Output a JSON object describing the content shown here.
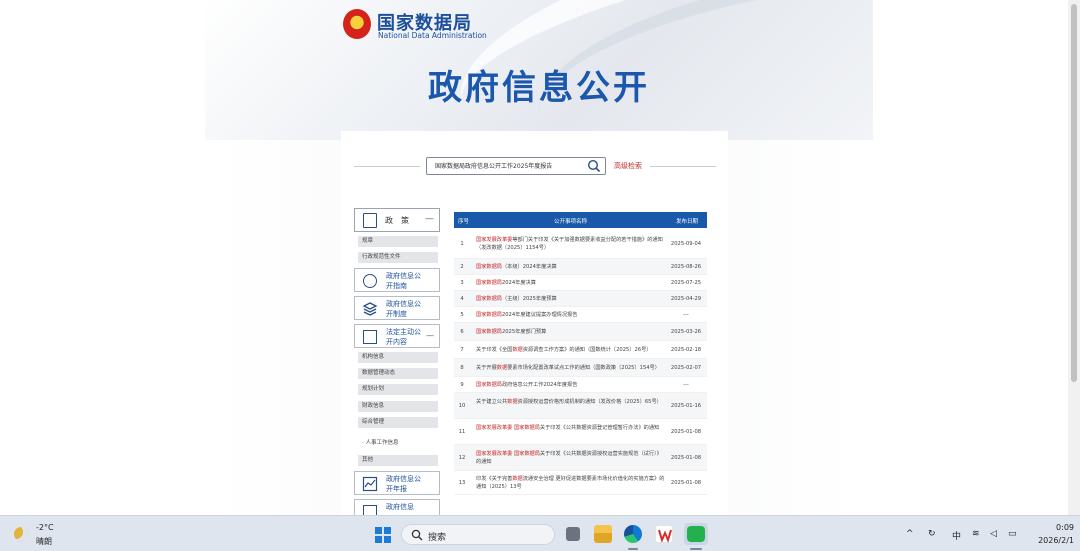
{
  "site": {
    "logo_cn": "国家数据局",
    "logo_en": "National Data Administration",
    "page_title": "政府信息公开"
  },
  "search": {
    "query": "国家数据局政府信息公开工作2025年度报告",
    "advanced_label": "高级检索"
  },
  "sidebar": {
    "head_label": "政策",
    "items": [
      {
        "kind": "gray",
        "label": "规章"
      },
      {
        "kind": "gray",
        "label": "行政规范性文件"
      },
      {
        "kind": "card",
        "label": "政府信息公开指南",
        "icon": "compass-icon"
      },
      {
        "kind": "card",
        "label": "政府信息公开制度",
        "icon": "layers-icon"
      },
      {
        "kind": "card",
        "label": "法定主动公开内容",
        "icon": "document-list-icon"
      },
      {
        "kind": "gray",
        "label": "机构信息"
      },
      {
        "kind": "gray",
        "label": "数据管理动态"
      },
      {
        "kind": "gray",
        "label": "规划计划"
      },
      {
        "kind": "gray",
        "label": "财政信息"
      },
      {
        "kind": "gray",
        "label": "综合管理"
      },
      {
        "kind": "sub",
        "label": "· 人事工作信息"
      },
      {
        "kind": "gray",
        "label": "其他"
      },
      {
        "kind": "card",
        "label": "政府信息公开年报",
        "icon": "chart-icon"
      },
      {
        "kind": "card",
        "label": "政府信息",
        "icon": "doc-icon"
      }
    ]
  },
  "table": {
    "headers": [
      "序号",
      "公开事项名称",
      "发布日期"
    ],
    "rows": [
      {
        "no": "1",
        "pre": "",
        "red": "国家发展改革委",
        "post": "等部门关于印发《关于加强数据要素收益分配的若干措施》的通知（发改数据〔2025〕1154号）",
        "date": "2025-09-04"
      },
      {
        "no": "2",
        "pre": "",
        "red": "国家数据局",
        "post": "（本级）2024年度决算",
        "date": "2025-08-26"
      },
      {
        "no": "3",
        "pre": "",
        "red": "国家数据局",
        "post": "2024年度决算",
        "date": "2025-07-25"
      },
      {
        "no": "4",
        "pre": "",
        "red": "国家数据局",
        "post": "（主级）2025年度预算",
        "date": "2025-04-29"
      },
      {
        "no": "5",
        "pre": "",
        "red": "国家数据局",
        "post": "2024年度建议提案办理情况报告",
        "date": "---"
      },
      {
        "no": "6",
        "pre": "",
        "red": "国家数据局",
        "post": "2025年度部门预算",
        "date": "2025-03-26"
      },
      {
        "no": "7",
        "pre": "关于印发《全国",
        "red": "数据",
        "post": "资源调查工作方案》的通知（国数统计〔2025〕26号）",
        "date": "2025-02-18"
      },
      {
        "no": "8",
        "pre": "关于开展",
        "red": "数据",
        "post": "要素市场化配置改革试点工作的通知（国数政策〔2025〕154号）",
        "date": "2025-02-07"
      },
      {
        "no": "9",
        "pre": "",
        "red": "国家数据局",
        "post": "政府信息公开工作2024年度报告",
        "date": "---"
      },
      {
        "no": "10",
        "pre": "关于建立公共",
        "red": "数据",
        "post": "资源授权运营价格形成机制的通知（发改价格〔2025〕65号）",
        "date": "2025-01-16"
      },
      {
        "no": "11",
        "pre": "",
        "red": "国家发展改革委 国家数据局",
        "post": "关于印发《公共数据资源登记管理暂行办法》的通知",
        "date": "2025-01-08"
      },
      {
        "no": "12",
        "pre": "",
        "red": "国家发展改革委 国家数据局",
        "post": "关于印发《公共数据资源授权运营实施规范（试行）》的通知",
        "date": "2025-01-08"
      },
      {
        "no": "13",
        "pre": "印发《关于完善",
        "red": "数据",
        "post": "流通安全治理 更好促进数据要素市场化价值化的实施方案》的通知（2025）13号",
        "date": "2025-01-08"
      }
    ]
  },
  "taskbar": {
    "weather_temp": "-2°C",
    "weather_desc": "晴朗",
    "search_placeholder": "搜索",
    "apps": [
      "file-explorer",
      "edge-browser",
      "wps-office",
      "wechat"
    ],
    "tray_lang": "中",
    "clock_time": "0:09",
    "clock_date": "2026/2/1"
  },
  "colors": {
    "brand_blue": "#1a57ad",
    "table_header": "#1859a9",
    "highlight_red": "#c0282a"
  }
}
